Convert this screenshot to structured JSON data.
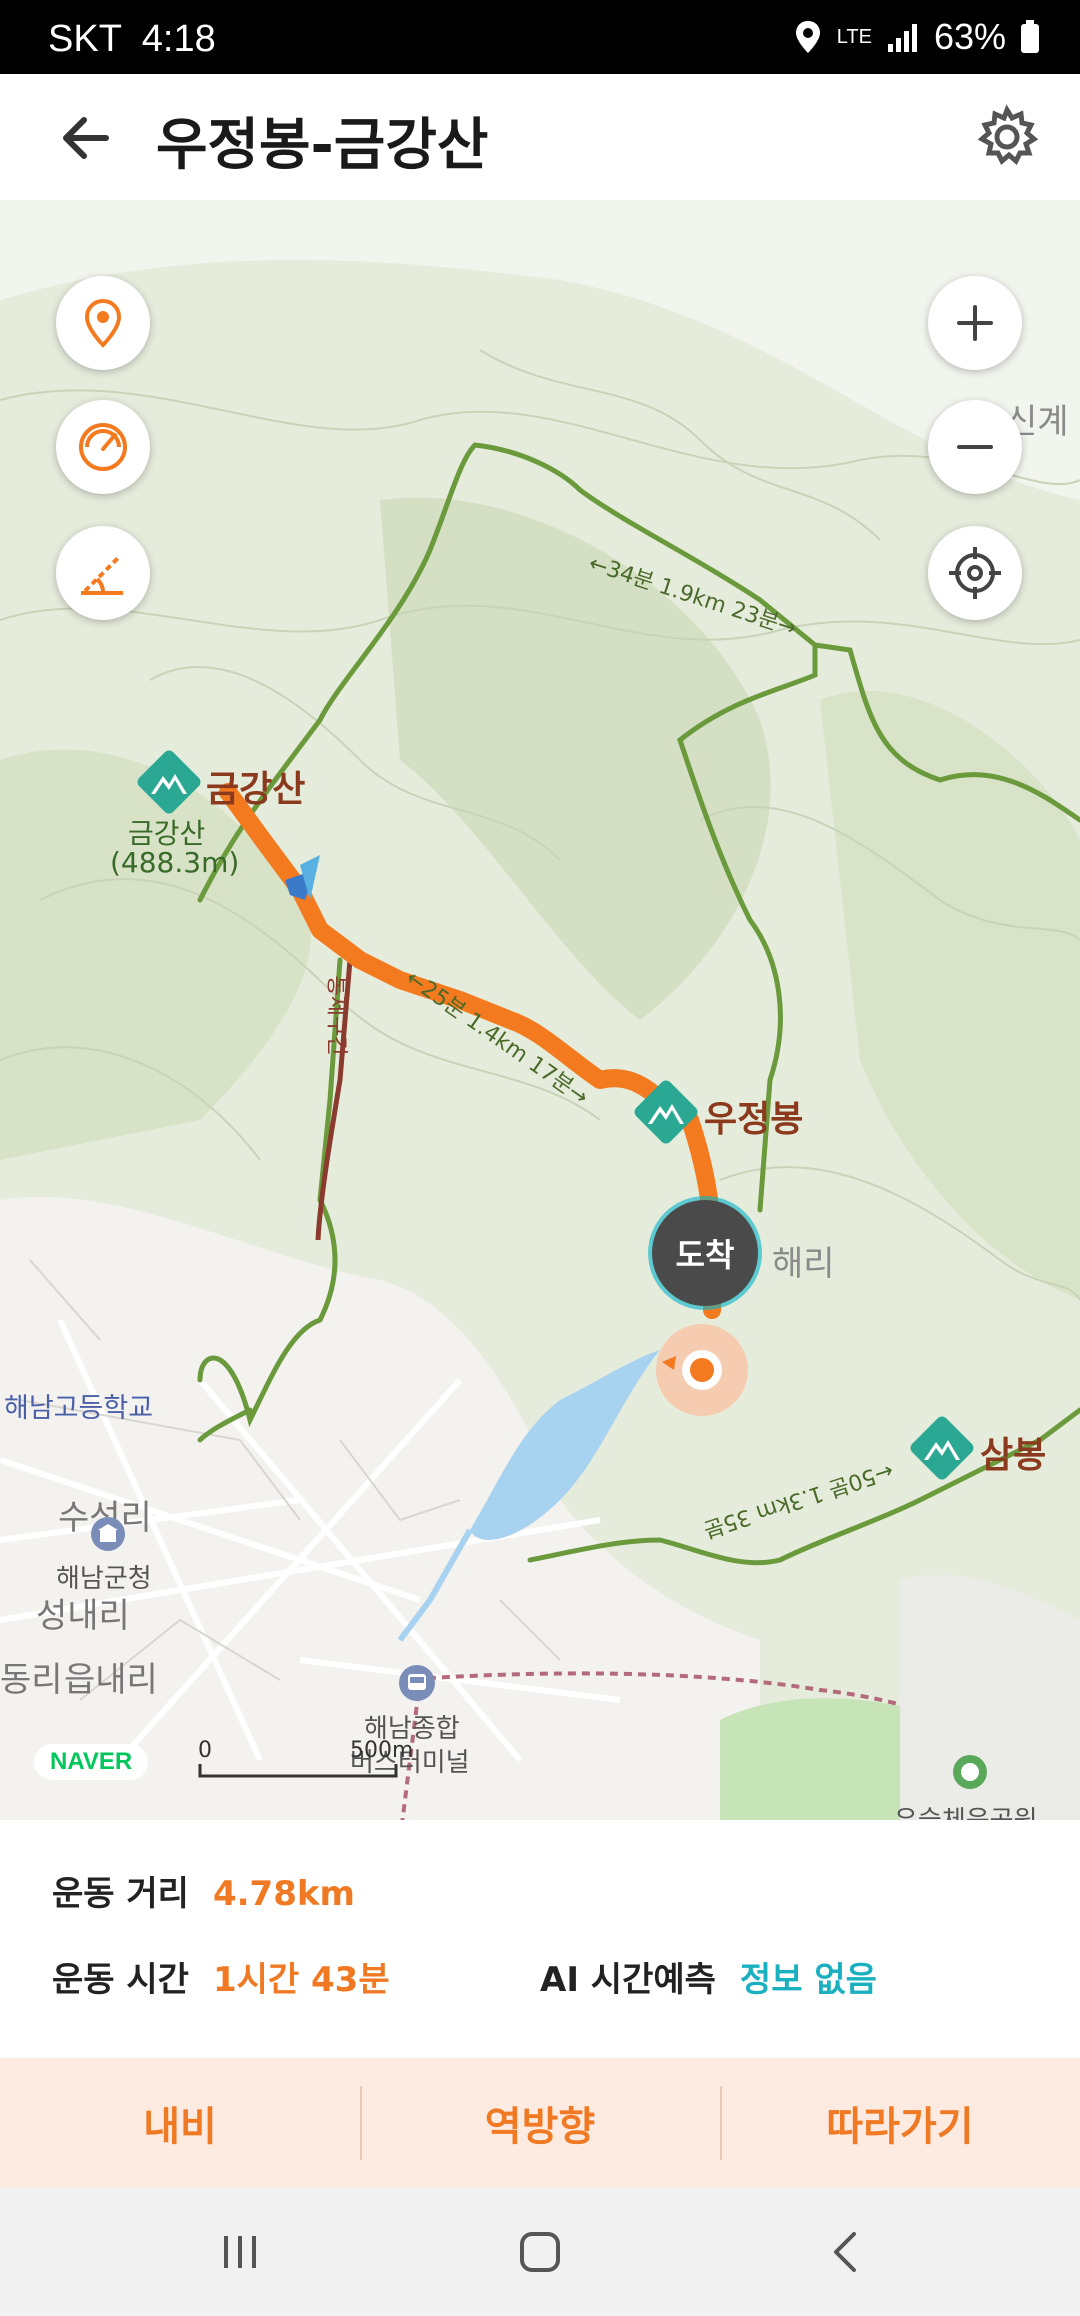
{
  "status_bar": {
    "carrier": "SKT",
    "time": "4:18",
    "network": "LTE",
    "battery": "63%",
    "icons": [
      "location-icon",
      "lte-icon",
      "signal-icon",
      "battery-icon"
    ]
  },
  "header": {
    "title": "우정봉-금강산",
    "back_icon": "arrow-left-icon",
    "settings_icon": "gear-icon"
  },
  "map": {
    "controls_left": [
      "location-pin-icon",
      "gauge-icon",
      "slope-icon"
    ],
    "controls_right": [
      "zoom-in-icon",
      "zoom-out-icon",
      "gps-crosshair-icon"
    ],
    "peaks": {
      "geumgangsan": "금강산",
      "geumgangsan_sub": "금강산",
      "geumgangsan_height": "(488.3m)",
      "ujeongbong": "우정봉",
      "sambong": "삼봉"
    },
    "trail_labels": {
      "top": "←34분 1.9km 23분→",
      "middle": "←25분 1.4km 17분→",
      "bottom": "←50분 1.3km 35분",
      "restricted": "통제구간"
    },
    "place_labels": {
      "haeri": "해리",
      "sinkye": "신계",
      "school": "해남고등학교",
      "suseongri": "수성리",
      "county_office": "해남군청",
      "seongnaeri": "성내리",
      "dongri": "동리",
      "ipnaeri": "읍내리",
      "terminal": "해남종합",
      "terminal2": "버스터미널",
      "park": "우슬체육공원"
    },
    "arrive_label": "도착",
    "brand": "NAVER",
    "scale_zero": "0",
    "scale_value": "500m",
    "colors": {
      "route": "#f47a20",
      "trail": "#6a9a3c",
      "water": "#a8d3f0",
      "terrain": "#dfe6d2"
    }
  },
  "info": {
    "distance_label": "운동 거리",
    "distance_value": "4.78km",
    "time_label": "운동 시간",
    "time_value": "1시간 43분",
    "ai_label": "AI 시간예측",
    "ai_value": "정보 없음"
  },
  "actions": {
    "navigate": "내비",
    "reverse": "역방향",
    "follow": "따라가기"
  },
  "nav_bar": {
    "icons": [
      "recent-apps-icon",
      "home-icon",
      "back-icon"
    ]
  }
}
